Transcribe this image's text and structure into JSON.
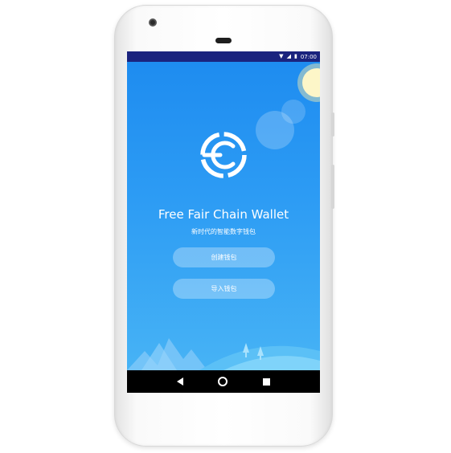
{
  "status_bar": {
    "time": "07:00",
    "icons": [
      "wifi-icon",
      "signal-icon",
      "battery-icon"
    ]
  },
  "app": {
    "logo_icon": "fair-chain-logo-icon",
    "title": "Free Fair Chain Wallet",
    "subtitle": "新时代的智能数字钱包",
    "create_button_label": "创建钱包",
    "import_button_label": "导入钱包"
  },
  "navigation": {
    "icons": [
      "back-icon",
      "home-icon",
      "recents-icon"
    ]
  },
  "colors": {
    "primary": "#2196f3",
    "status_bar": "#1a237e",
    "nav_bar": "#000000"
  }
}
